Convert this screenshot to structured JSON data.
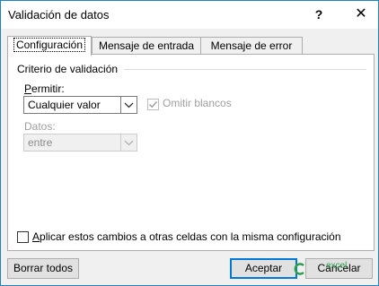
{
  "window": {
    "title": "Validación de datos",
    "help_glyph": "?",
    "close_glyph": "✕"
  },
  "tabs": [
    {
      "label": "Configuración",
      "active": true
    },
    {
      "label": "Mensaje de entrada",
      "active": false
    },
    {
      "label": "Mensaje de error",
      "active": false
    }
  ],
  "criteria": {
    "group_title": "Criterio de validación",
    "allow_label_first": "P",
    "allow_label_rest": "ermitir:",
    "allow_value": "Cualquier valor",
    "ignore_blank_label": "Omitir blancos",
    "ignore_blank_checked": true,
    "data_label": "Datos:",
    "data_value": "entre"
  },
  "apply_all": {
    "label_first": "A",
    "label_rest": "plicar estos cambios a otras celdas con la misma configuración",
    "checked": false
  },
  "buttons": {
    "clear_all": "Borrar todos",
    "ok": "Aceptar",
    "cancel": "Cancelar"
  },
  "watermark": {
    "text": "excel",
    "color": "#2e9e4f"
  },
  "colors": {
    "accent": "#0078d7",
    "window_border": "#1e82c8",
    "disabled_text": "#a0a0a0"
  }
}
